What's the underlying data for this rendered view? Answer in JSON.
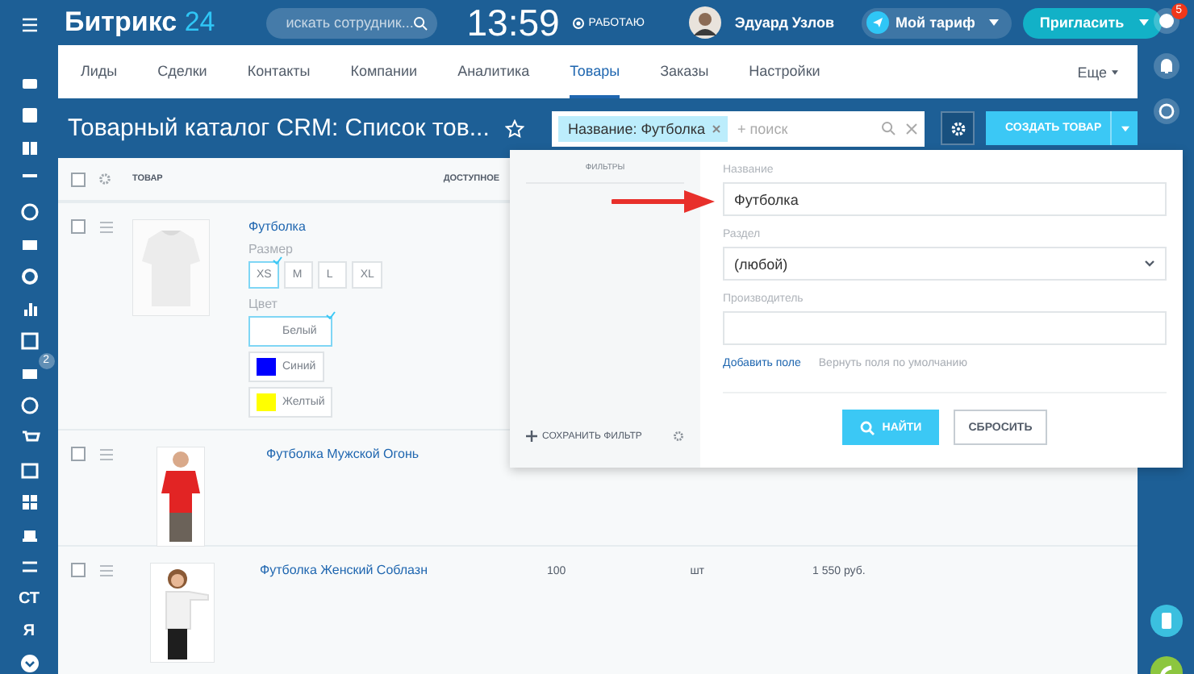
{
  "header": {
    "logo_name": "Битрикс",
    "logo_number": "24",
    "search_placeholder": "искать сотрудник...",
    "time": "13:59",
    "status": "РАБОТАЮ",
    "user": "Эдуард Узлов",
    "tariff": "Мой тариф",
    "invite": "Пригласить"
  },
  "left_sidebar": {
    "mail_badge": "2",
    "text_items": [
      "СТ",
      "Я"
    ]
  },
  "right_sidebar": {
    "help_badge": "5"
  },
  "nav": {
    "tabs": [
      {
        "label": "Лиды",
        "selected": false
      },
      {
        "label": "Сделки",
        "selected": false
      },
      {
        "label": "Контакты",
        "selected": false
      },
      {
        "label": "Компании",
        "selected": false
      },
      {
        "label": "Аналитика",
        "selected": false
      },
      {
        "label": "Товары",
        "selected": true
      },
      {
        "label": "Заказы",
        "selected": false
      },
      {
        "label": "Настройки",
        "selected": false
      }
    ],
    "more": "Еще"
  },
  "page_title": "Товарный каталог CRM: Список тов...",
  "filter_bar": {
    "chip": "Название: Футболка",
    "placeholder": "+ поиск"
  },
  "create_button": "СОЗДАТЬ ТОВАР",
  "table": {
    "header_checked": false,
    "columns": [
      "ТОВАР",
      "ДОСТУПНОЕ"
    ],
    "rows": [
      {
        "checked": false,
        "name": "Футболка",
        "size_label": "Размер",
        "sizes": [
          {
            "label": "XS",
            "selected": true
          },
          {
            "label": "M",
            "selected": false
          },
          {
            "label": "L",
            "selected": false
          },
          {
            "label": "XL",
            "selected": false
          }
        ],
        "color_label": "Цвет",
        "colors": [
          {
            "label": "Белый",
            "selected": true
          },
          {
            "label": "Синий",
            "color": "#0000ff",
            "selected": false
          },
          {
            "label": "Желтый",
            "color": "#ffff00",
            "selected": false
          }
        ]
      },
      {
        "checked": false,
        "name": "Футболка Мужской Огонь"
      },
      {
        "checked": false,
        "name": "Футболка Женский Соблазн",
        "quantity": "100",
        "unit": "шт",
        "price": "1 550 руб."
      }
    ]
  },
  "filter_popup": {
    "presets_title": "ФИЛЬТРЫ",
    "save_filter": "СОХРАНИТЬ ФИЛЬТР",
    "fields": [
      {
        "kind": "text",
        "label": "Название",
        "value": "Футболка"
      },
      {
        "kind": "select",
        "label": "Раздел",
        "value": "(любой)"
      },
      {
        "kind": "text",
        "label": "Производитель"
      }
    ],
    "add_field": "Добавить поле",
    "restore_fields": "Вернуть поля по умолчанию",
    "find": "НАЙТИ",
    "reset": "СБРОСИТЬ"
  }
}
